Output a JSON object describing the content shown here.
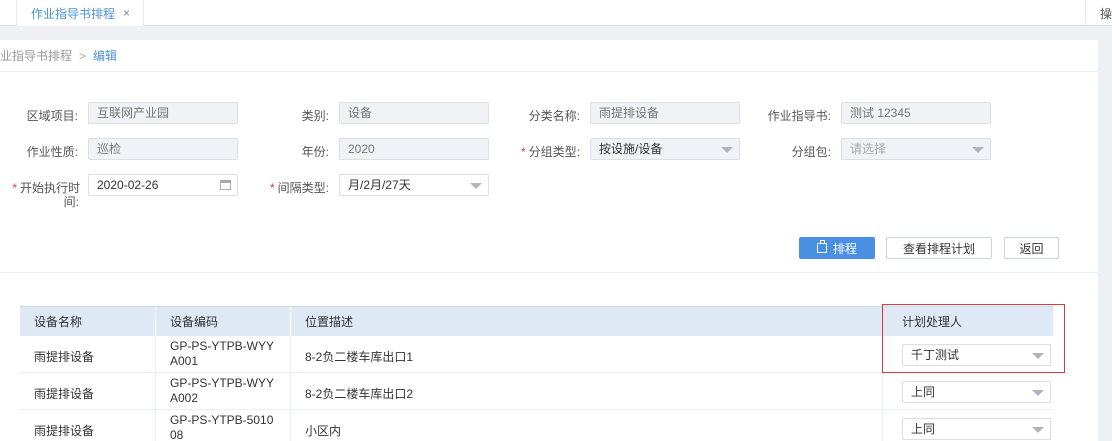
{
  "tab": {
    "label": "作业指导书排程",
    "close": "×"
  },
  "tabbar_right": "操",
  "breadcrumb": {
    "parent": "业指导书排程",
    "sep": ">",
    "current": "编辑"
  },
  "form": {
    "area_project": {
      "label": "区域项目:",
      "value": "互联网产业园"
    },
    "category": {
      "label": "类别:",
      "value": "设备"
    },
    "class_name": {
      "label": "分类名称:",
      "value": "雨提排设备"
    },
    "guide_book": {
      "label": "作业指导书:",
      "value": "测试 12345"
    },
    "work_nature": {
      "label": "作业性质:",
      "value": "巡检"
    },
    "year": {
      "label": "年份:",
      "value": "2020"
    },
    "group_type": {
      "label": "分组类型:",
      "value": "按设施/设备",
      "required": "*"
    },
    "group_pack": {
      "label": "分组包:",
      "value": "请选择"
    },
    "start_time": {
      "label_line1": "开始执行时",
      "label_line2": "间:",
      "value": "2020-02-26",
      "required": "*"
    },
    "interval_type": {
      "label": "间隔类型:",
      "value": "月/2月/27天",
      "required": "*"
    }
  },
  "buttons": {
    "schedule": "排程",
    "view_plan": "查看排程计划",
    "back": "返回"
  },
  "table": {
    "headers": [
      "设备名称",
      "设备编码",
      "位置描述",
      "计划处理人"
    ],
    "rows": [
      {
        "name": "雨提排设备",
        "code_line1": "GP-PS-YTPB-WYY",
        "code_line2": "A001",
        "location": "8-2负二楼车库出口1",
        "handler": "千丁测试"
      },
      {
        "name": "雨提排设备",
        "code_line1": "GP-PS-YTPB-WYY",
        "code_line2": "A002",
        "location": "8-2负二楼车库出口2",
        "handler": "上同"
      },
      {
        "name": "雨提排设备",
        "code_line1": "GP-PS-YTPB-5010",
        "code_line2": "08",
        "location": "小区内",
        "handler": "上同"
      }
    ]
  },
  "colors": {
    "accent": "#4a90e2",
    "highlight": "#d9393e",
    "header_bg": "#dfe9f6"
  }
}
